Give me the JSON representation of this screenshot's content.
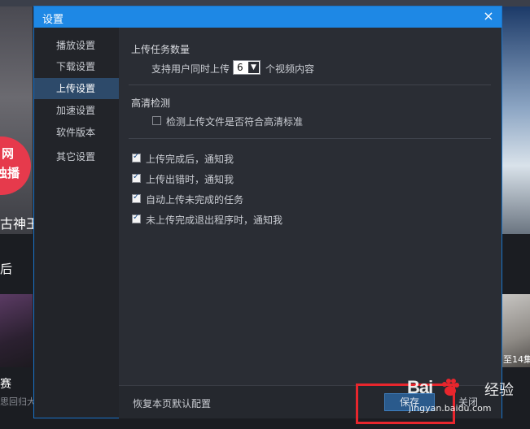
{
  "background": {
    "left_badge_lines": [
      "网",
      "独播"
    ],
    "left_title": "古神王",
    "left_text": "后",
    "left_caption": "赛",
    "left_sub": "思回归大",
    "right_caption": "至14集"
  },
  "dialog": {
    "title": "设置",
    "close_icon": "×"
  },
  "sidebar": {
    "items": [
      {
        "label": "播放设置"
      },
      {
        "label": "下载设置"
      },
      {
        "label": "上传设置"
      },
      {
        "label": "加速设置"
      },
      {
        "label": "软件版本"
      },
      {
        "label": "其它设置"
      }
    ],
    "active_index": 2
  },
  "upload": {
    "section_title": "上传任务数量",
    "concurrent_prefix": "支持用户同时上传",
    "concurrent_value": "6",
    "concurrent_suffix": "个视频内容"
  },
  "hd": {
    "section_title": "高清检测",
    "check_label": "检测上传文件是否符合高清标准",
    "checked": false
  },
  "notify": {
    "items": [
      {
        "label": "上传完成后，通知我",
        "checked": true
      },
      {
        "label": "上传出错时，通知我",
        "checked": true
      },
      {
        "label": "自动上传未完成的任务",
        "checked": true
      },
      {
        "label": "未上传完成退出程序时，通知我",
        "checked": true
      }
    ]
  },
  "footer": {
    "reset_label": "恢复本页默认配置",
    "save_label": "保存",
    "close_label": "关闭"
  },
  "watermark": {
    "logo": "Bai",
    "brand": "经验",
    "url": "jingyan.baidu.com"
  },
  "colors": {
    "titlebar": "#1e88e5",
    "active_nav": "#2d4a6a",
    "highlight": "#e8262d"
  }
}
